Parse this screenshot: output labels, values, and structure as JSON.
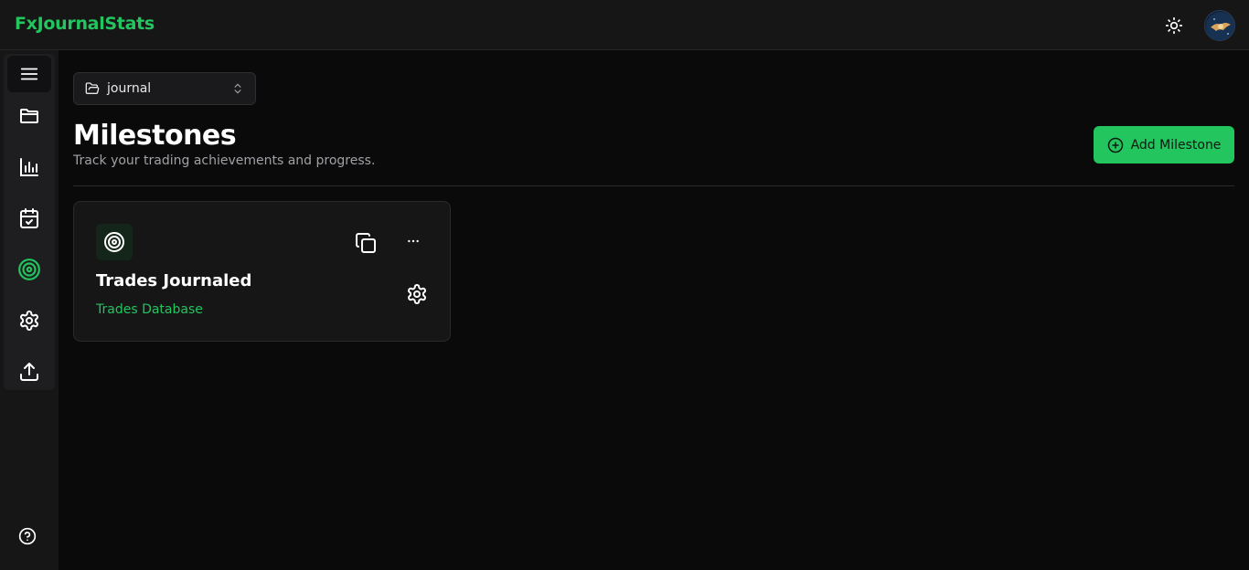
{
  "app": {
    "brand": "FxJournalStats"
  },
  "header": {
    "theme_icon": "sun-icon",
    "avatar_icon": "avatar-image"
  },
  "sidebar": {
    "items": [
      {
        "name": "menu",
        "icon": "hamburger-icon"
      },
      {
        "name": "journals",
        "icon": "folder-icon"
      },
      {
        "name": "statistics",
        "icon": "bar-chart-icon"
      },
      {
        "name": "calendar",
        "icon": "calendar-check-icon"
      },
      {
        "name": "milestones",
        "icon": "target-icon",
        "active": true
      },
      {
        "name": "settings",
        "icon": "gear-icon"
      },
      {
        "name": "export",
        "icon": "upload-icon"
      }
    ],
    "help_icon": "help-circle-icon"
  },
  "journal_selector": {
    "value": "journal"
  },
  "page": {
    "title": "Milestones",
    "subtitle": "Track your trading achievements and progress.",
    "add_button_label": "Add Milestone"
  },
  "milestones": [
    {
      "title": "Trades Journaled",
      "source": "Trades Database"
    }
  ],
  "colors": {
    "accent": "#22c55e",
    "background": "#0a0a0b",
    "surface": "#161617"
  }
}
